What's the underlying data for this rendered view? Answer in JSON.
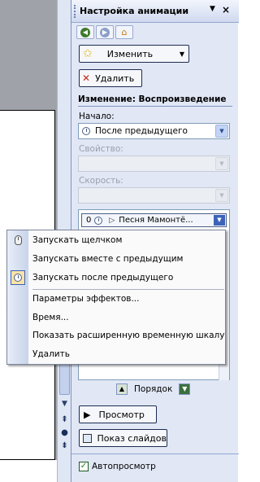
{
  "task_pane": {
    "title": "Настройка анимации",
    "change_button_label": "Изменить",
    "delete_button_label": "Удалить",
    "section_title": "Изменение: Воспроизведение",
    "start_label": "Начало:",
    "start_value": "После предыдущего",
    "property_label": "Свойство:",
    "speed_label": "Скорость:",
    "effect_item": {
      "index": "0",
      "name": "Песня Мамонтё..."
    },
    "order_label": "Порядок",
    "preview_button_label": "Просмотр",
    "slideshow_button_label": "Показ слайдов",
    "autopreview_label": "Автопросмотр",
    "autopreview_checked": true
  },
  "context_menu": {
    "items": [
      {
        "label": "Запускать щелчком"
      },
      {
        "label": "Запускать вместе с предыдущим"
      },
      {
        "label": "Запускать после предыдущего"
      },
      {
        "label": "Параметры эффектов..."
      },
      {
        "label": "Время..."
      },
      {
        "label": "Показать расширенную временную шкалу"
      },
      {
        "label": "Удалить"
      }
    ]
  },
  "colors": {
    "pane_background": "#e1e7f5",
    "workspace_background": "#9fa2a8",
    "accent": "#3c63b8"
  }
}
